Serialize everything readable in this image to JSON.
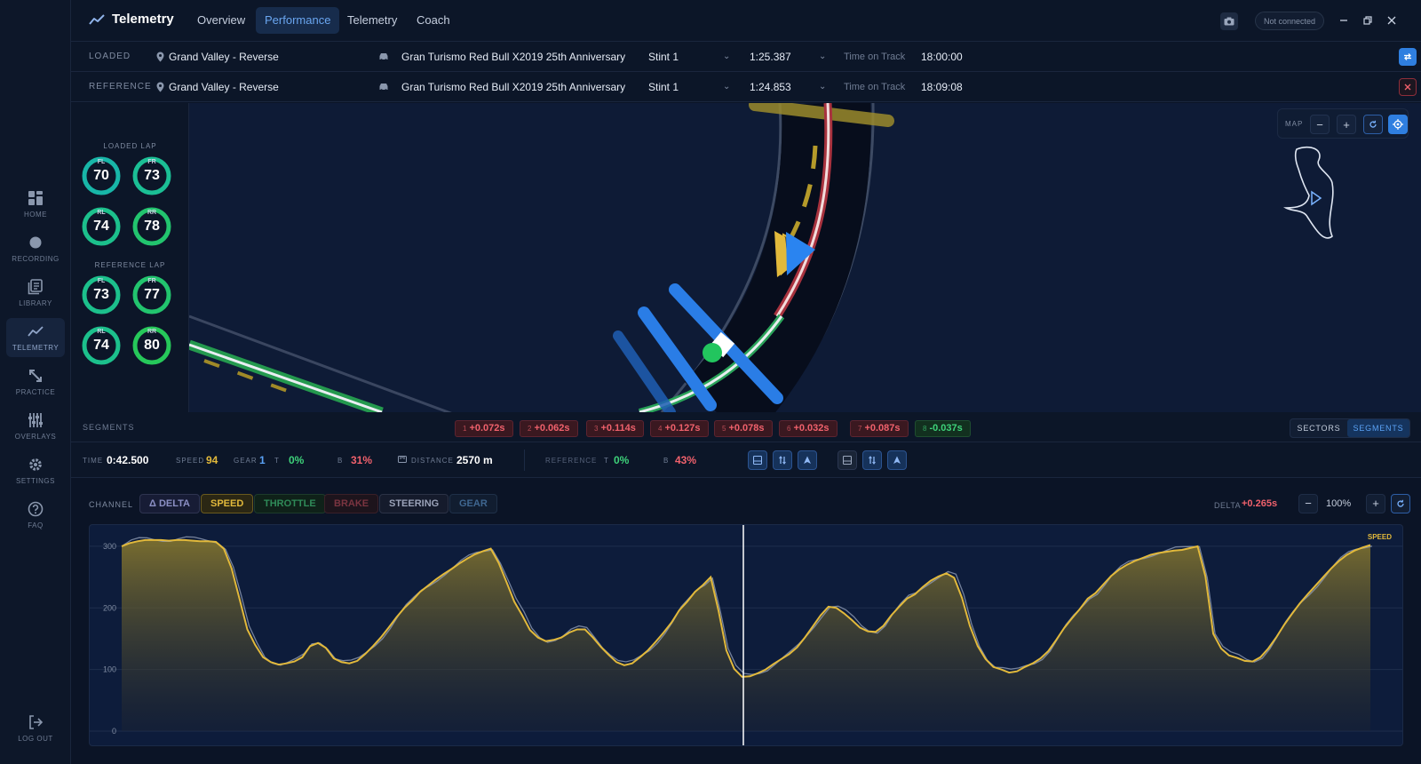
{
  "nav": {
    "items": [
      {
        "label": "HOME",
        "icon": "home-grid-icon"
      },
      {
        "label": "RECORDING",
        "icon": "record-dot-icon"
      },
      {
        "label": "LIBRARY",
        "icon": "library-icon"
      },
      {
        "label": "TELEMETRY",
        "icon": "telemetry-chart-icon",
        "active": true
      },
      {
        "label": "PRACTICE",
        "icon": "practice-arrows-icon"
      },
      {
        "label": "OVERLAYS",
        "icon": "overlays-sliders-icon"
      },
      {
        "label": "SETTINGS",
        "icon": "gear-icon"
      },
      {
        "label": "FAQ",
        "icon": "question-icon"
      }
    ],
    "logout": "LOG OUT"
  },
  "header": {
    "brand": "Telemetry",
    "tabs": [
      "Overview",
      "Performance",
      "Telemetry",
      "Coach"
    ],
    "active_tab": "Performance",
    "connection": "Not connected"
  },
  "loaded": {
    "label": "LOADED",
    "track": "Grand Valley - Reverse",
    "car": "Gran Turismo Red Bull X2019 25th Anniversary",
    "stint": "Stint 1",
    "laptime": "1:25.387",
    "tot_label": "Time on Track",
    "tot": "18:00:00"
  },
  "reference": {
    "label": "REFERENCE",
    "track": "Grand Valley - Reverse",
    "car": "Gran Turismo Red Bull X2019 25th Anniversary",
    "stint": "Stint 1",
    "laptime": "1:24.853",
    "tot_label": "Time on Track",
    "tot": "18:09:08"
  },
  "tyres": {
    "loaded_label": "LOADED LAP",
    "reference_label": "REFERENCE LAP",
    "loaded": {
      "FL": "70",
      "FR": "73",
      "RL": "74",
      "RR": "78"
    },
    "reference": {
      "FL": "73",
      "FR": "77",
      "RL": "74",
      "RR": "80"
    },
    "pos": {
      "FL": "FL",
      "FR": "FR",
      "RL": "RL",
      "RR": "RR"
    }
  },
  "map": {
    "label": "MAP",
    "minus": "−",
    "plus": "+"
  },
  "segments": {
    "label": "SEGMENTS",
    "chips": [
      {
        "n": "1",
        "delta": "+0.072s"
      },
      {
        "n": "2",
        "delta": "+0.062s"
      },
      {
        "n": "3",
        "delta": "+0.114s"
      },
      {
        "n": "4",
        "delta": "+0.127s"
      },
      {
        "n": "5",
        "delta": "+0.078s"
      },
      {
        "n": "6",
        "delta": "+0.032s"
      },
      {
        "n": "7",
        "delta": "+0.087s"
      },
      {
        "n": "8",
        "delta": "-0.037s"
      }
    ],
    "toggle": [
      "SECTORS",
      "SEGMENTS"
    ]
  },
  "info": {
    "time_label": "TIME",
    "time": "0:42.500",
    "speed_label": "SPEED",
    "speed": "94",
    "gear_label": "GEAR",
    "gear": "1",
    "t_label": "T",
    "t": "0%",
    "b_label": "B",
    "b": "31%",
    "distance_label": "DISTANCE",
    "distance": "2570 m",
    "ref_label": "REFERENCE",
    "ref_t_label": "T",
    "ref_t": "0%",
    "ref_b_label": "B",
    "ref_b": "43%"
  },
  "channel": {
    "label": "CHANNEL",
    "buttons": [
      "Δ DELTA",
      "SPEED",
      "THROTTLE",
      "BRAKE",
      "STEERING",
      "GEAR"
    ],
    "delta_label": "DELTA",
    "delta_value": "+0.265s",
    "zoom": "100%",
    "minus": "−",
    "plus": "+"
  },
  "colors": {
    "accent": "#3b82f6",
    "speed": "#e2b93b",
    "positive_delta": "#f0616c",
    "negative_delta": "#3ed27a"
  },
  "chart_data": {
    "type": "line",
    "series": [
      {
        "name": "SPEED",
        "color": "#e2b93b",
        "values": [
          300,
          305,
          308,
          310,
          310,
          310,
          309,
          310,
          310,
          309,
          308,
          308,
          307,
          296,
          264,
          215,
          165,
          140,
          120,
          112,
          108,
          110,
          113,
          120,
          138,
          143,
          135,
          118,
          112,
          110,
          114,
          125,
          138,
          152,
          168,
          185,
          200,
          212,
          226,
          236,
          246,
          255,
          263,
          272,
          280,
          287,
          292,
          296,
          273,
          242,
          210,
          188,
          164,
          152,
          146,
          148,
          152,
          160,
          165,
          165,
          152,
          137,
          124,
          112,
          107,
          110,
          120,
          131,
          145,
          160,
          176,
          196,
          210,
          226,
          237,
          250,
          195,
          131,
          101,
          88,
          89,
          94,
          100,
          109,
          117,
          125,
          136,
          152,
          170,
          188,
          202,
          200,
          191,
          180,
          168,
          162,
          161,
          171,
          188,
          202,
          215,
          222,
          234,
          244,
          251,
          256,
          249,
          216,
          171,
          138,
          117,
          104,
          100,
          95,
          97,
          104,
          110,
          118,
          130,
          148,
          167,
          183,
          198,
          215,
          224,
          238,
          252,
          262,
          270,
          276,
          281,
          286,
          289,
          291,
          293,
          294,
          297,
          300,
          251,
          158,
          134,
          123,
          119,
          114,
          113,
          120,
          134,
          152,
          172,
          190,
          207,
          222,
          236,
          250,
          264,
          276,
          286,
          293,
          298,
          302
        ]
      }
    ],
    "ylim": [
      0,
      320
    ],
    "yticks": [
      0,
      100,
      200,
      300
    ],
    "label": "SPEED",
    "grid": true
  }
}
